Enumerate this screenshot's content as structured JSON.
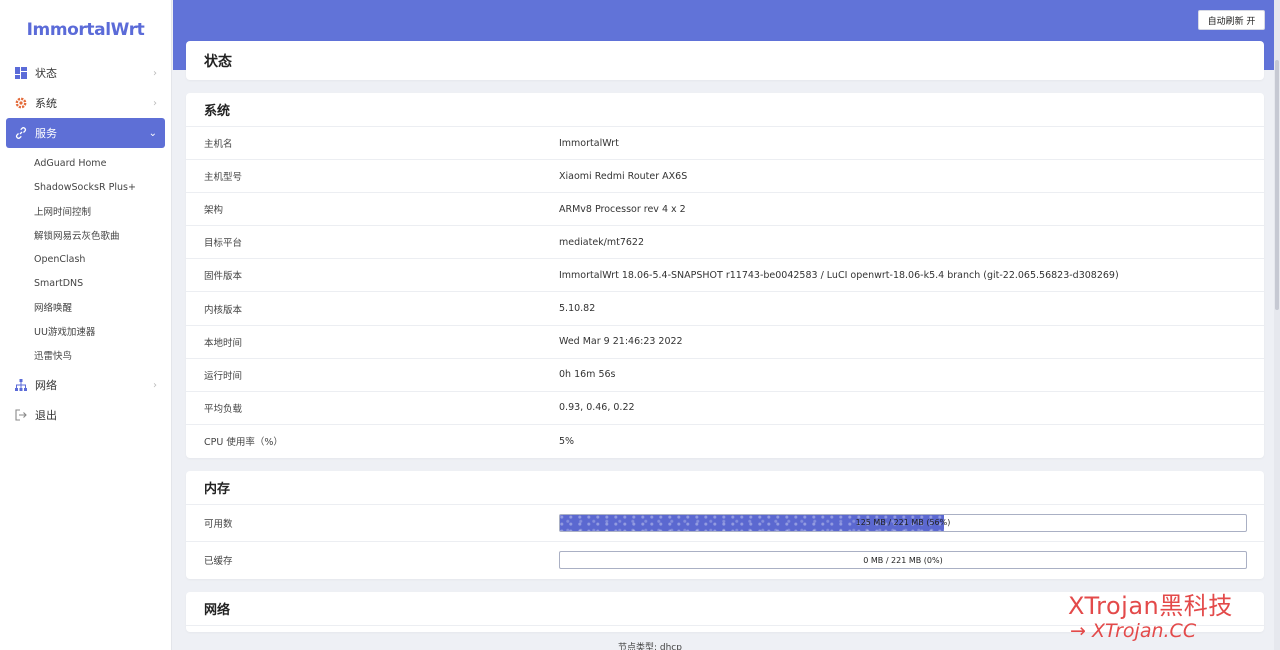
{
  "app": {
    "logo": "ImmortalWrt",
    "auto_refresh": "自动刷新 开"
  },
  "sidebar": {
    "items": [
      {
        "label": "状态",
        "icon": "dashboard-icon"
      },
      {
        "label": "系统",
        "icon": "gear-icon"
      },
      {
        "label": "服务",
        "icon": "link-icon",
        "active": true
      },
      {
        "label": "网络",
        "icon": "network-icon"
      },
      {
        "label": "退出",
        "icon": "logout-icon"
      }
    ],
    "services_sub": [
      "AdGuard Home",
      "ShadowSocksR Plus+",
      "上网时间控制",
      "解锁网易云灰色歌曲",
      "OpenClash",
      "SmartDNS",
      "网络唤醒",
      "UU游戏加速器",
      "迅雷快鸟"
    ]
  },
  "page": {
    "title": "状态"
  },
  "system": {
    "title": "系统",
    "rows": [
      {
        "k": "主机名",
        "v": "ImmortalWrt"
      },
      {
        "k": "主机型号",
        "v": "Xiaomi Redmi Router AX6S"
      },
      {
        "k": "架构",
        "v": "ARMv8 Processor rev 4 x 2"
      },
      {
        "k": "目标平台",
        "v": "mediatek/mt7622"
      },
      {
        "k": "固件版本",
        "v": "ImmortalWrt 18.06-5.4-SNAPSHOT r11743-be0042583 / LuCI openwrt-18.06-k5.4 branch (git-22.065.56823-d308269)"
      },
      {
        "k": "内核版本",
        "v": "5.10.82"
      },
      {
        "k": "本地时间",
        "v": "Wed Mar 9 21:46:23 2022"
      },
      {
        "k": "运行时间",
        "v": "0h 16m 56s"
      },
      {
        "k": "平均负载",
        "v": "0.93, 0.46, 0.22"
      },
      {
        "k": "CPU 使用率（%）",
        "v": "5%"
      }
    ]
  },
  "memory": {
    "title": "内存",
    "rows": [
      {
        "k": "可用数",
        "text": "125 MB / 221 MB (56%)",
        "fraction": 0.56
      },
      {
        "k": "已缓存",
        "text": "0 MB / 221 MB (0%)",
        "fraction": 0.0
      }
    ]
  },
  "network": {
    "title": "网络",
    "peek": "节点类型: dhcp"
  },
  "watermark": {
    "line1": "XTrojan黑科技",
    "line2": "→ XTrojan.CC"
  },
  "colors": {
    "accent": "#6173d8",
    "active_nav": "#5e6fd6",
    "bar_fill": "#5b68d0",
    "watermark": "#e34a4a"
  }
}
